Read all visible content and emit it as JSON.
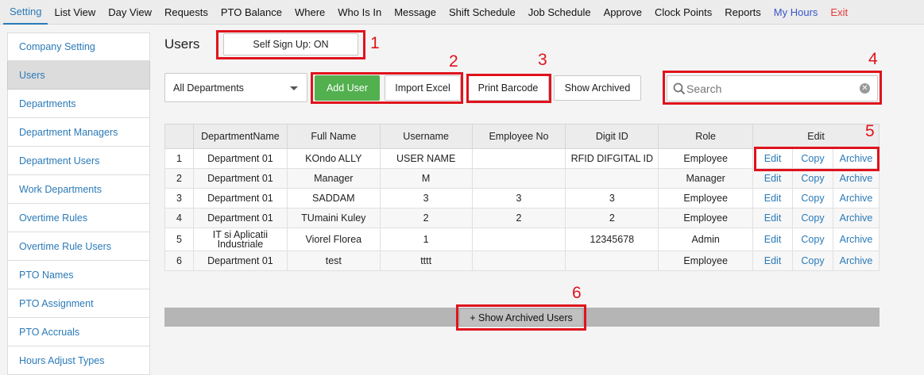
{
  "topnav": [
    {
      "label": "Setting",
      "state": "active"
    },
    {
      "label": "List View"
    },
    {
      "label": "Day View"
    },
    {
      "label": "Requests"
    },
    {
      "label": "PTO Balance"
    },
    {
      "label": "Where"
    },
    {
      "label": "Who Is In"
    },
    {
      "label": "Message"
    },
    {
      "label": "Shift Schedule"
    },
    {
      "label": "Job Schedule"
    },
    {
      "label": "Approve"
    },
    {
      "label": "Clock Points"
    },
    {
      "label": "Reports"
    },
    {
      "label": "My Hours",
      "color": "#3a55c8"
    },
    {
      "label": "Exit",
      "color": "#e53935"
    }
  ],
  "sidebar": [
    {
      "label": "Company Setting"
    },
    {
      "label": "Users",
      "active": true
    },
    {
      "label": "Departments"
    },
    {
      "label": "Department Managers"
    },
    {
      "label": "Department Users"
    },
    {
      "label": "Work Departments"
    },
    {
      "label": "Overtime Rules"
    },
    {
      "label": "Overtime Rule Users"
    },
    {
      "label": "PTO Names"
    },
    {
      "label": "PTO Assignment"
    },
    {
      "label": "PTO Accruals"
    },
    {
      "label": "Hours Adjust Types"
    }
  ],
  "page": {
    "title": "Users",
    "self_signup_label": "Self Sign Up: ON"
  },
  "toolbar": {
    "department_select": "All Departments",
    "add_user": "Add User",
    "import_excel": "Import Excel",
    "print_barcode": "Print Barcode",
    "show_archived": "Show Archived"
  },
  "search": {
    "placeholder": "Search",
    "value": ""
  },
  "annotations": [
    "1",
    "2",
    "3",
    "4",
    "5",
    "6"
  ],
  "table": {
    "headers": [
      "",
      "DepartmentName",
      "Full Name",
      "Username",
      "Employee No",
      "Digit ID",
      "Role",
      "Edit"
    ],
    "rows": [
      {
        "num": "1",
        "department": "Department 01",
        "full_name": "KOndo ALLY",
        "username": "USER NAME",
        "employee_no": "",
        "digit_id": "RFID DIFGITAL ID",
        "role": "Employee"
      },
      {
        "num": "2",
        "department": "Department 01",
        "full_name": "Manager",
        "username": "M",
        "employee_no": "",
        "digit_id": "",
        "role": "Manager"
      },
      {
        "num": "3",
        "department": "Department 01",
        "full_name": "SADDAM",
        "username": "3",
        "employee_no": "3",
        "digit_id": "3",
        "role": "Employee"
      },
      {
        "num": "4",
        "department": "Department 01",
        "full_name": "TUmaini Kuley",
        "username": "2",
        "employee_no": "2",
        "digit_id": "2",
        "role": "Employee"
      },
      {
        "num": "5",
        "department": "IT si Aplicatii Industriale",
        "full_name": "Viorel Florea",
        "username": "1",
        "employee_no": "",
        "digit_id": "12345678",
        "role": "Admin"
      },
      {
        "num": "6",
        "department": "Department 01",
        "full_name": "test",
        "username": "tttt",
        "employee_no": "",
        "digit_id": "",
        "role": "Employee"
      }
    ],
    "actions": {
      "edit": "Edit",
      "copy": "Copy",
      "archive": "Archive"
    }
  },
  "footer": {
    "show_archived_users": "+ Show Archived Users"
  },
  "colors": {
    "accent": "#2a7ab8",
    "add_user_green": "#52b04f",
    "annotation_red": "#e0131d"
  }
}
